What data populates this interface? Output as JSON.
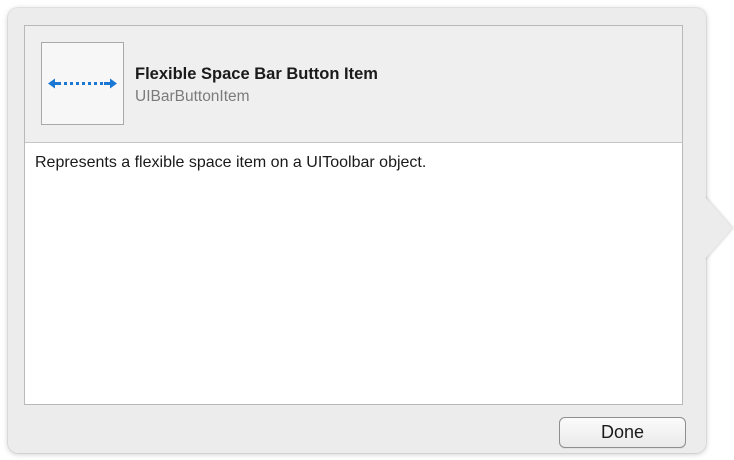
{
  "item": {
    "title": "Flexible Space Bar Button Item",
    "class_name": "UIBarButtonItem",
    "description": "Represents a flexible space item on a UIToolbar object.",
    "icon": "flexible-space-arrows-icon"
  },
  "footer": {
    "done_label": "Done"
  },
  "colors": {
    "icon_accent": "#1a78d4",
    "popover_background": "#ececec"
  }
}
